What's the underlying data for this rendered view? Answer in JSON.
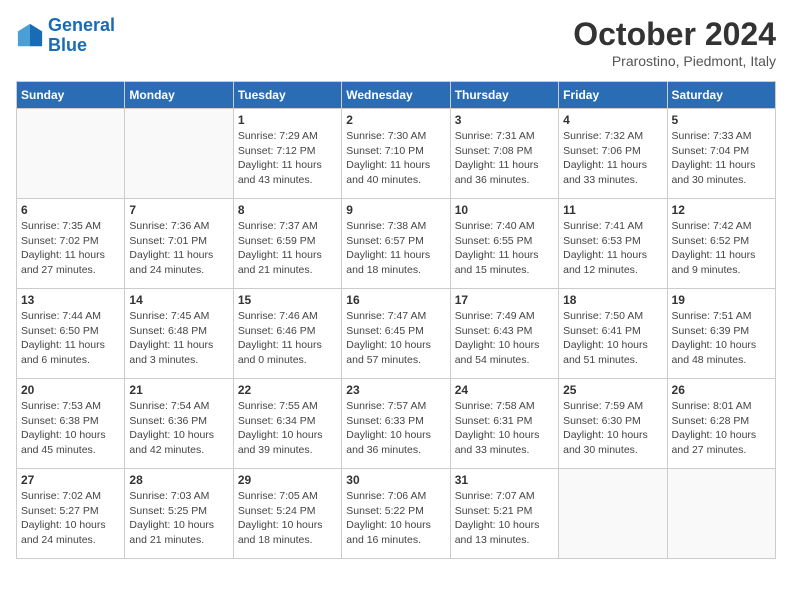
{
  "logo": {
    "text_general": "General",
    "text_blue": "Blue"
  },
  "header": {
    "month": "October 2024",
    "location": "Prarostino, Piedmont, Italy"
  },
  "weekdays": [
    "Sunday",
    "Monday",
    "Tuesday",
    "Wednesday",
    "Thursday",
    "Friday",
    "Saturday"
  ],
  "weeks": [
    [
      {
        "day": "",
        "sunrise": "",
        "sunset": "",
        "daylight": ""
      },
      {
        "day": "",
        "sunrise": "",
        "sunset": "",
        "daylight": ""
      },
      {
        "day": "1",
        "sunrise": "Sunrise: 7:29 AM",
        "sunset": "Sunset: 7:12 PM",
        "daylight": "Daylight: 11 hours and 43 minutes."
      },
      {
        "day": "2",
        "sunrise": "Sunrise: 7:30 AM",
        "sunset": "Sunset: 7:10 PM",
        "daylight": "Daylight: 11 hours and 40 minutes."
      },
      {
        "day": "3",
        "sunrise": "Sunrise: 7:31 AM",
        "sunset": "Sunset: 7:08 PM",
        "daylight": "Daylight: 11 hours and 36 minutes."
      },
      {
        "day": "4",
        "sunrise": "Sunrise: 7:32 AM",
        "sunset": "Sunset: 7:06 PM",
        "daylight": "Daylight: 11 hours and 33 minutes."
      },
      {
        "day": "5",
        "sunrise": "Sunrise: 7:33 AM",
        "sunset": "Sunset: 7:04 PM",
        "daylight": "Daylight: 11 hours and 30 minutes."
      }
    ],
    [
      {
        "day": "6",
        "sunrise": "Sunrise: 7:35 AM",
        "sunset": "Sunset: 7:02 PM",
        "daylight": "Daylight: 11 hours and 27 minutes."
      },
      {
        "day": "7",
        "sunrise": "Sunrise: 7:36 AM",
        "sunset": "Sunset: 7:01 PM",
        "daylight": "Daylight: 11 hours and 24 minutes."
      },
      {
        "day": "8",
        "sunrise": "Sunrise: 7:37 AM",
        "sunset": "Sunset: 6:59 PM",
        "daylight": "Daylight: 11 hours and 21 minutes."
      },
      {
        "day": "9",
        "sunrise": "Sunrise: 7:38 AM",
        "sunset": "Sunset: 6:57 PM",
        "daylight": "Daylight: 11 hours and 18 minutes."
      },
      {
        "day": "10",
        "sunrise": "Sunrise: 7:40 AM",
        "sunset": "Sunset: 6:55 PM",
        "daylight": "Daylight: 11 hours and 15 minutes."
      },
      {
        "day": "11",
        "sunrise": "Sunrise: 7:41 AM",
        "sunset": "Sunset: 6:53 PM",
        "daylight": "Daylight: 11 hours and 12 minutes."
      },
      {
        "day": "12",
        "sunrise": "Sunrise: 7:42 AM",
        "sunset": "Sunset: 6:52 PM",
        "daylight": "Daylight: 11 hours and 9 minutes."
      }
    ],
    [
      {
        "day": "13",
        "sunrise": "Sunrise: 7:44 AM",
        "sunset": "Sunset: 6:50 PM",
        "daylight": "Daylight: 11 hours and 6 minutes."
      },
      {
        "day": "14",
        "sunrise": "Sunrise: 7:45 AM",
        "sunset": "Sunset: 6:48 PM",
        "daylight": "Daylight: 11 hours and 3 minutes."
      },
      {
        "day": "15",
        "sunrise": "Sunrise: 7:46 AM",
        "sunset": "Sunset: 6:46 PM",
        "daylight": "Daylight: 11 hours and 0 minutes."
      },
      {
        "day": "16",
        "sunrise": "Sunrise: 7:47 AM",
        "sunset": "Sunset: 6:45 PM",
        "daylight": "Daylight: 10 hours and 57 minutes."
      },
      {
        "day": "17",
        "sunrise": "Sunrise: 7:49 AM",
        "sunset": "Sunset: 6:43 PM",
        "daylight": "Daylight: 10 hours and 54 minutes."
      },
      {
        "day": "18",
        "sunrise": "Sunrise: 7:50 AM",
        "sunset": "Sunset: 6:41 PM",
        "daylight": "Daylight: 10 hours and 51 minutes."
      },
      {
        "day": "19",
        "sunrise": "Sunrise: 7:51 AM",
        "sunset": "Sunset: 6:39 PM",
        "daylight": "Daylight: 10 hours and 48 minutes."
      }
    ],
    [
      {
        "day": "20",
        "sunrise": "Sunrise: 7:53 AM",
        "sunset": "Sunset: 6:38 PM",
        "daylight": "Daylight: 10 hours and 45 minutes."
      },
      {
        "day": "21",
        "sunrise": "Sunrise: 7:54 AM",
        "sunset": "Sunset: 6:36 PM",
        "daylight": "Daylight: 10 hours and 42 minutes."
      },
      {
        "day": "22",
        "sunrise": "Sunrise: 7:55 AM",
        "sunset": "Sunset: 6:34 PM",
        "daylight": "Daylight: 10 hours and 39 minutes."
      },
      {
        "day": "23",
        "sunrise": "Sunrise: 7:57 AM",
        "sunset": "Sunset: 6:33 PM",
        "daylight": "Daylight: 10 hours and 36 minutes."
      },
      {
        "day": "24",
        "sunrise": "Sunrise: 7:58 AM",
        "sunset": "Sunset: 6:31 PM",
        "daylight": "Daylight: 10 hours and 33 minutes."
      },
      {
        "day": "25",
        "sunrise": "Sunrise: 7:59 AM",
        "sunset": "Sunset: 6:30 PM",
        "daylight": "Daylight: 10 hours and 30 minutes."
      },
      {
        "day": "26",
        "sunrise": "Sunrise: 8:01 AM",
        "sunset": "Sunset: 6:28 PM",
        "daylight": "Daylight: 10 hours and 27 minutes."
      }
    ],
    [
      {
        "day": "27",
        "sunrise": "Sunrise: 7:02 AM",
        "sunset": "Sunset: 5:27 PM",
        "daylight": "Daylight: 10 hours and 24 minutes."
      },
      {
        "day": "28",
        "sunrise": "Sunrise: 7:03 AM",
        "sunset": "Sunset: 5:25 PM",
        "daylight": "Daylight: 10 hours and 21 minutes."
      },
      {
        "day": "29",
        "sunrise": "Sunrise: 7:05 AM",
        "sunset": "Sunset: 5:24 PM",
        "daylight": "Daylight: 10 hours and 18 minutes."
      },
      {
        "day": "30",
        "sunrise": "Sunrise: 7:06 AM",
        "sunset": "Sunset: 5:22 PM",
        "daylight": "Daylight: 10 hours and 16 minutes."
      },
      {
        "day": "31",
        "sunrise": "Sunrise: 7:07 AM",
        "sunset": "Sunset: 5:21 PM",
        "daylight": "Daylight: 10 hours and 13 minutes."
      },
      {
        "day": "",
        "sunrise": "",
        "sunset": "",
        "daylight": ""
      },
      {
        "day": "",
        "sunrise": "",
        "sunset": "",
        "daylight": ""
      }
    ]
  ]
}
